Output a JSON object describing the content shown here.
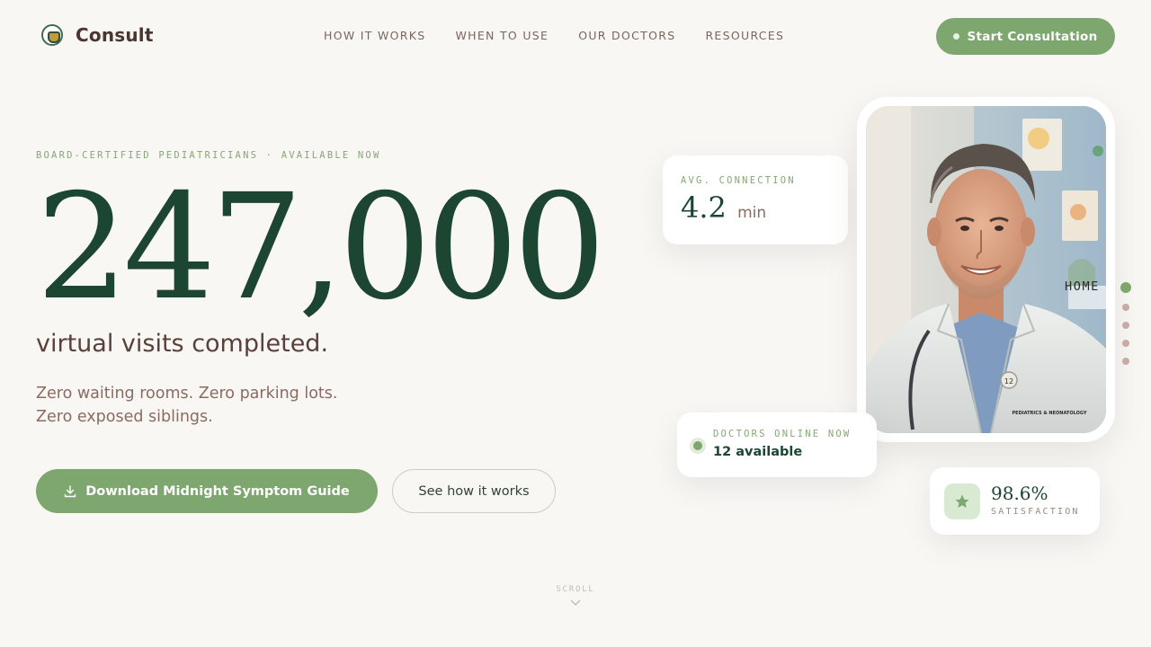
{
  "brand": {
    "name": "Consult"
  },
  "nav": {
    "items": [
      "HOW IT WORKS",
      "WHEN TO USE",
      "OUR DOCTORS",
      "RESOURCES"
    ]
  },
  "header": {
    "cta_label": "Start Consultation"
  },
  "hero": {
    "eyebrow": "BOARD-CERTIFIED PEDIATRICIANS · AVAILABLE NOW",
    "count": "247,000",
    "headline": "virtual visits completed.",
    "tagline_line1": "Zero waiting rooms. Zero parking lots.",
    "tagline_line2": "Zero exposed siblings.",
    "primary_button": "Download Midnight Symptom Guide",
    "secondary_button": "See how it works"
  },
  "stats": {
    "connection": {
      "label": "AVG. CONNECTION",
      "value": "4.2",
      "unit": "min"
    },
    "online": {
      "label": "DOCTORS ONLINE NOW",
      "value": "12 available"
    },
    "satisfaction": {
      "value": "98.6%",
      "label": "SATISFACTION"
    }
  },
  "doctor_photo": {
    "badge_text": "PEDIATRICS & NEONATOLOGY",
    "pin_number": "12"
  },
  "side_nav": {
    "label": "HOME",
    "sections": 5,
    "active_index": 0
  },
  "scroll": {
    "label": "SCROLL"
  },
  "colors": {
    "accent": "#7ea66f",
    "deep_green": "#1c4532",
    "background": "#f8f7f4",
    "brown_text": "#5a4038"
  }
}
